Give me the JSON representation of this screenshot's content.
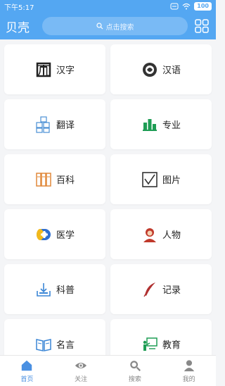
{
  "status": {
    "time": "下午5:17",
    "battery": "100"
  },
  "header": {
    "title": "贝壳",
    "search_placeholder": "点击搜索"
  },
  "categories": [
    {
      "label": "汉字",
      "icon": "hanzi-icon"
    },
    {
      "label": "汉语",
      "icon": "hanyu-icon"
    },
    {
      "label": "翻译",
      "icon": "translate-icon"
    },
    {
      "label": "专业",
      "icon": "major-icon"
    },
    {
      "label": "百科",
      "icon": "encyclopedia-icon"
    },
    {
      "label": "图片",
      "icon": "picture-icon"
    },
    {
      "label": "医学",
      "icon": "medicine-icon"
    },
    {
      "label": "人物",
      "icon": "person-icon"
    },
    {
      "label": "科普",
      "icon": "science-icon"
    },
    {
      "label": "记录",
      "icon": "record-icon"
    },
    {
      "label": "名言",
      "icon": "quote-icon"
    },
    {
      "label": "教育",
      "icon": "education-icon"
    }
  ],
  "nav": [
    {
      "label": "首页",
      "icon": "home-icon",
      "active": true
    },
    {
      "label": "关注",
      "icon": "eye-icon",
      "active": false
    },
    {
      "label": "搜索",
      "icon": "search-icon",
      "active": false
    },
    {
      "label": "我的",
      "icon": "user-icon",
      "active": false
    }
  ],
  "colors": {
    "header": "#54a7f2",
    "active_nav": "#4a90e2",
    "background": "#f4f5f7"
  }
}
